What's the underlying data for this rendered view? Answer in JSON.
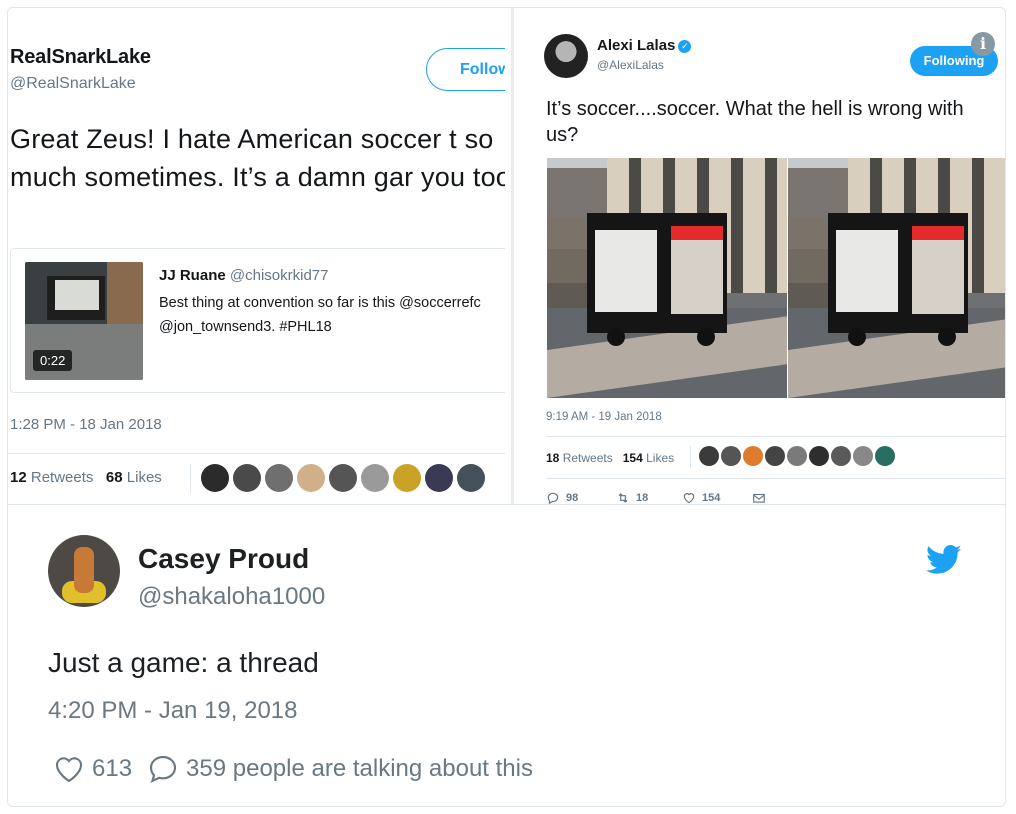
{
  "left_tweet": {
    "display_name": "RealSnarkLake",
    "handle": "@RealSnarkLake",
    "follow_label": "Follow",
    "text": "Great Zeus! I hate American soccer t so much sometimes. It’s a damn gar you tools!",
    "quoted": {
      "display_name": "JJ Ruane",
      "handle": "@chisokrkid77",
      "text": "Best thing at convention so far is this @soccerrefc\n@jon_townsend3. #PHL18",
      "video_duration": "0:22"
    },
    "timestamp": "1:28 PM - 18 Jan 2018",
    "retweets_count": "12",
    "retweets_label": "Retweets",
    "likes_count": "68",
    "likes_label": "Likes",
    "liker_avatars": [
      "#2b2b2b",
      "#4a4a4a",
      "#6f6f6f",
      "#d1b089",
      "#555555",
      "#9a9a9a",
      "#c9a227",
      "#3a3a55",
      "#44505a"
    ]
  },
  "right_tweet": {
    "display_name": "Alexi Lalas",
    "handle": "@AlexiLalas",
    "following_label": "Following",
    "text": "It’s soccer....soccer. What the hell is wrong with us?",
    "timestamp": "9:19 AM - 19 Jan 2018",
    "retweets_count": "18",
    "retweets_label": "Retweets",
    "likes_count": "154",
    "likes_label": "Likes",
    "liker_avatars": [
      "#3b3b3b",
      "#555555",
      "#e07b2e",
      "#444444",
      "#7a7a7a",
      "#2e2e2e",
      "#5a5a5a",
      "#888888",
      "#2a6d63"
    ],
    "replies": "98",
    "retweets_action": "18",
    "likes_action": "154"
  },
  "embed": {
    "display_name": "Casey Proud",
    "handle": "@shakaloha1000",
    "text": "Just a game: a thread",
    "timestamp": "4:20 PM - Jan 19, 2018",
    "likes": "613",
    "talking": "359 people are talking about this",
    "brand_color": "#1da1f2"
  }
}
